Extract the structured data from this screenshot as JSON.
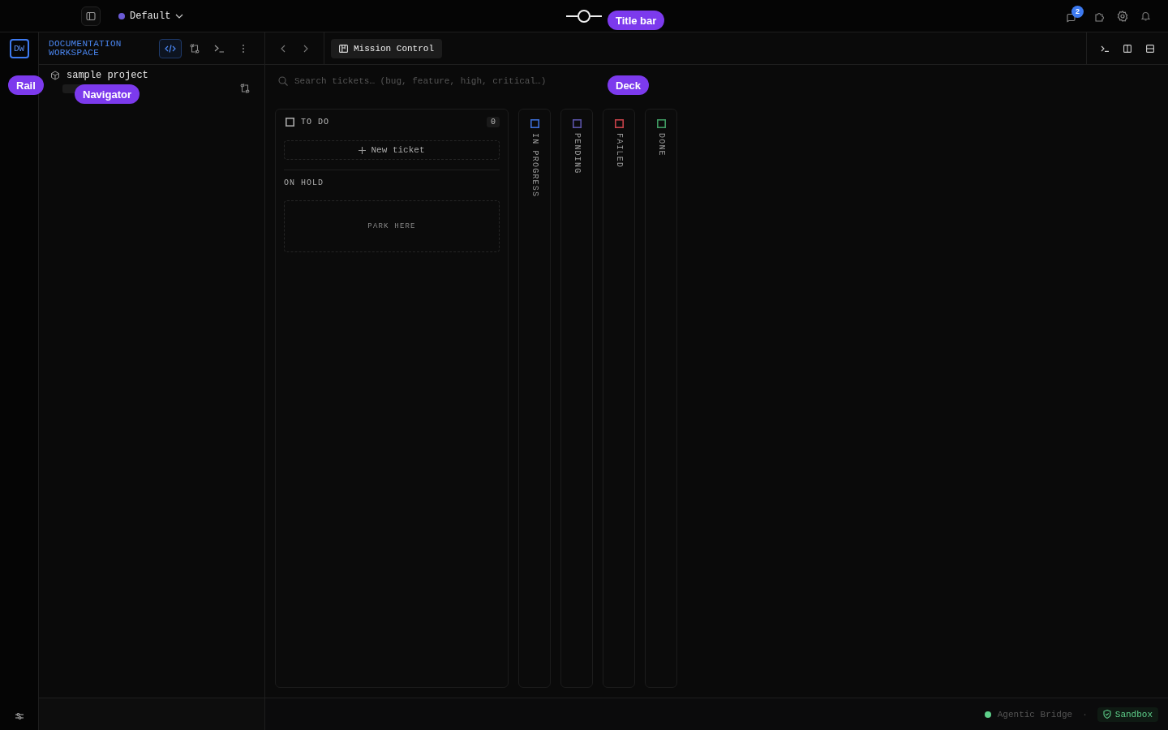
{
  "title_bar": {
    "profile": {
      "label": "Default",
      "color": "#6b5bd6"
    },
    "notification_count": "2"
  },
  "annotations": [
    {
      "label": "Title bar"
    },
    {
      "label": "Rail"
    },
    {
      "label": "Navigator"
    },
    {
      "label": "Deck"
    }
  ],
  "rail": {
    "logo": "DW"
  },
  "navigator": {
    "title": "DOCUMENTATION WORKSPACE",
    "tools": [
      {
        "kind": "code",
        "selected": true
      },
      {
        "kind": "git",
        "selected": false
      },
      {
        "kind": "terminal",
        "selected": false
      },
      {
        "kind": "more",
        "selected": false
      }
    ],
    "project": "sample project"
  },
  "tabs": [
    {
      "label": "Mission Control",
      "selected": true
    }
  ],
  "search": {
    "placeholder": "Search tickets… (bug, feature, high, critical…)"
  },
  "columns": [
    {
      "title": "TO DO",
      "count": "0",
      "expanded": true,
      "color": "#a8a8a8",
      "new_ticket": "New ticket",
      "section": "ON HOLD",
      "drop_zone": "PARK HERE"
    },
    {
      "title": "IN PROGRESS",
      "expanded": false,
      "color": "#3d6fd8"
    },
    {
      "title": "PENDING",
      "expanded": false,
      "color": "#5b54a8"
    },
    {
      "title": "FAILED",
      "expanded": false,
      "color": "#c8424a"
    },
    {
      "title": "DONE",
      "expanded": false,
      "color": "#3f9a62"
    }
  ],
  "status_bar": {
    "bridge": {
      "label": "Agentic Bridge",
      "color": "#5ecf8a"
    },
    "separator": "·",
    "sandbox": "Sandbox"
  }
}
